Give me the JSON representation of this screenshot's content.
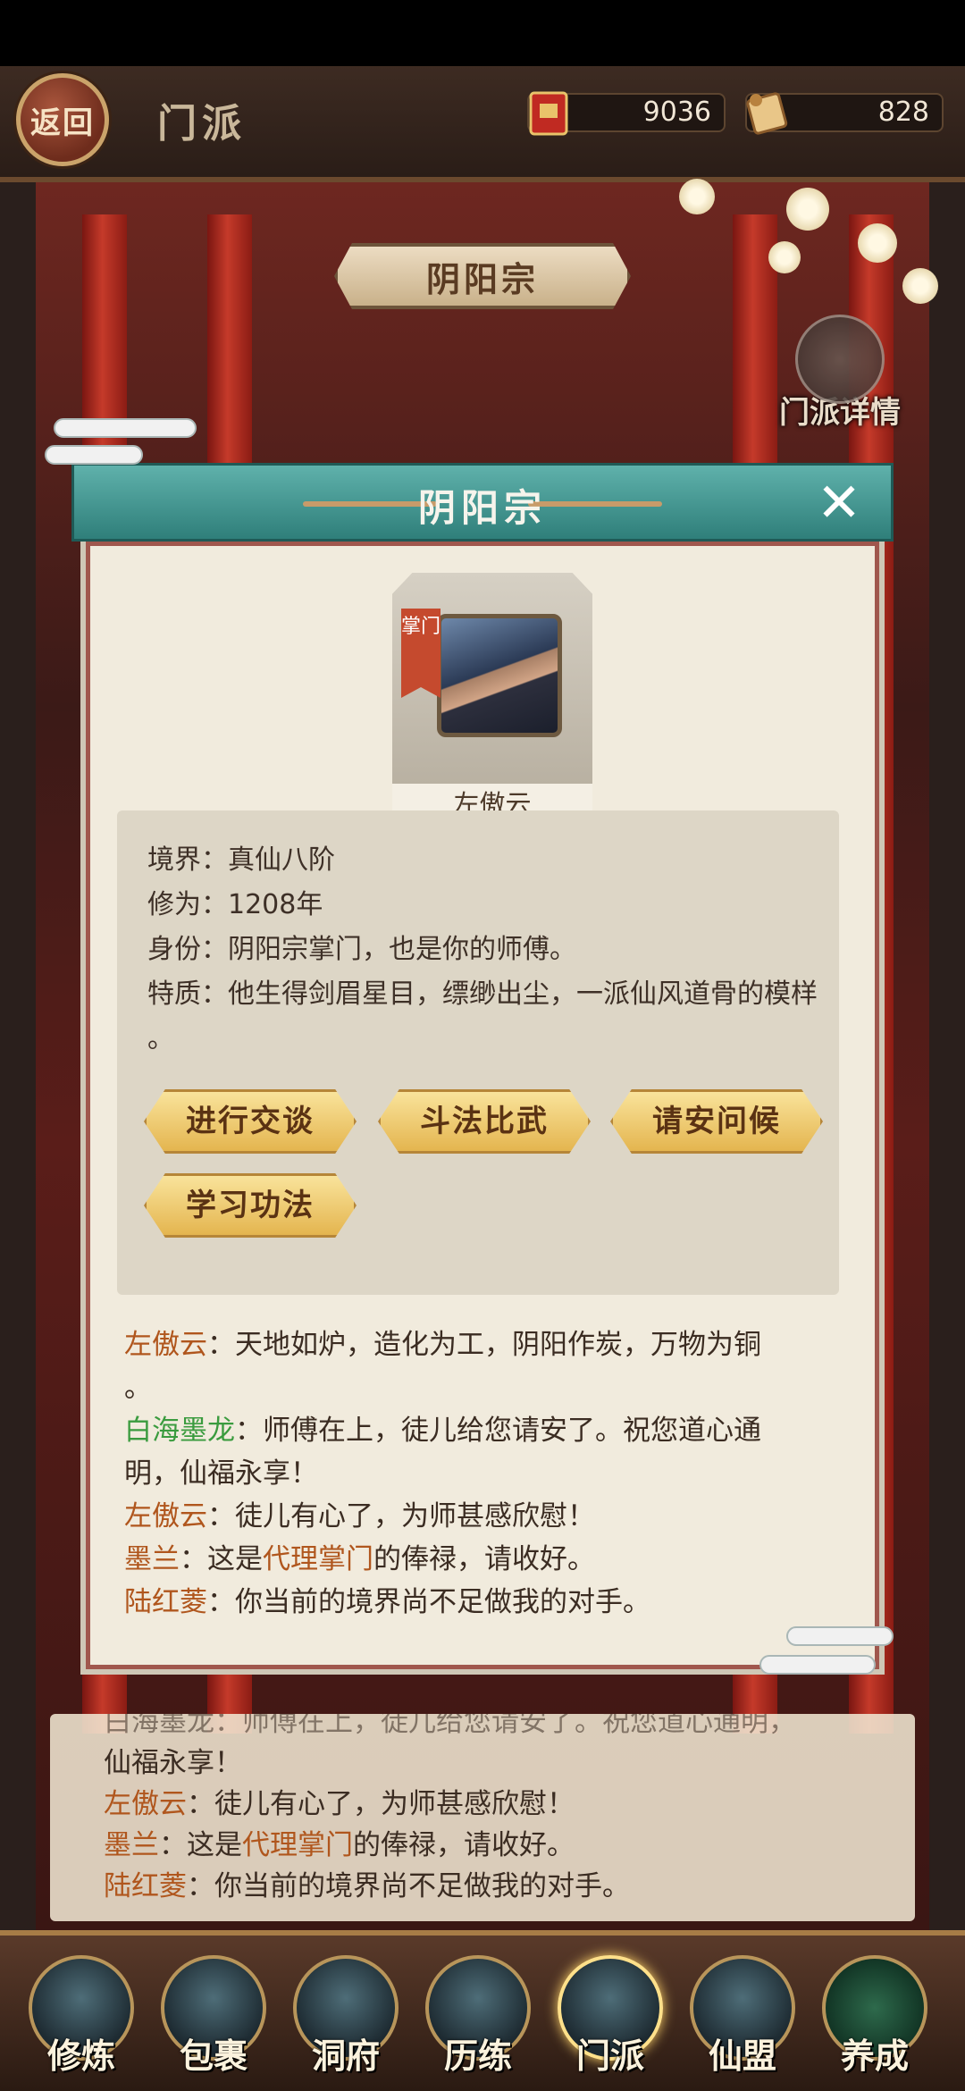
{
  "header": {
    "back_label": "返回",
    "title": "门派",
    "currency": [
      {
        "icon": "red-envelope-token-icon",
        "value": "9036"
      },
      {
        "icon": "scroll-token-icon",
        "value": "828"
      }
    ]
  },
  "hall": {
    "sect_banner": "阴阳宗",
    "sect_detail_label": "门派详情"
  },
  "modal": {
    "title": "阴阳宗",
    "close": "✕",
    "master": {
      "badge": "掌门",
      "name": "左傲云"
    },
    "info": {
      "realm": "境界：真仙八阶",
      "cultivation": "修为：1208年",
      "identity": "身份：阴阳宗掌门，也是你的师傅。",
      "trait_1": "特质：他生得剑眉星目，缥缈出尘，一派仙风道骨的模样",
      "trait_2": "。"
    },
    "actions": [
      "进行交谈",
      "斗法比武",
      "请安问候",
      "学习功法"
    ],
    "dialog": [
      {
        "speaker": "左傲云",
        "text": "：天地如炉，造化为工，阴阳作炭，万物为铜",
        "cont": "。"
      },
      {
        "speaker": "白海墨龙",
        "text": "：师傅在上，徒儿给您请安了。祝您道心通",
        "cont": "明，仙福永享！"
      },
      {
        "speaker": "左傲云",
        "text": "：徒儿有心了，为师甚感欣慰！"
      },
      {
        "speaker": "墨兰",
        "pre": "：这是",
        "highlight": "代理掌门",
        "post": "的俸禄，请收好。"
      },
      {
        "speaker": "陆红菱",
        "text": "：你当前的境界尚不足做我的对手。"
      }
    ]
  },
  "chatlog": {
    "rows": [
      {
        "text": "白海墨龙：师傅在上，徒儿给您请安了。祝您道心通明，"
      },
      {
        "text": "仙福永享！"
      },
      {
        "speaker": "左傲云",
        "text": "：徒儿有心了，为师甚感欣慰！"
      },
      {
        "speaker": "墨兰",
        "pre": "：这是",
        "highlight": "代理掌门",
        "post": "的俸禄，请收好。"
      },
      {
        "speaker": "陆红菱",
        "text": "：你当前的境界尚不足做我的对手。"
      }
    ]
  },
  "nav": [
    "修炼",
    "包裹",
    "洞府",
    "历练",
    "门派",
    "仙盟",
    "养成"
  ],
  "nav_active_index": 4
}
